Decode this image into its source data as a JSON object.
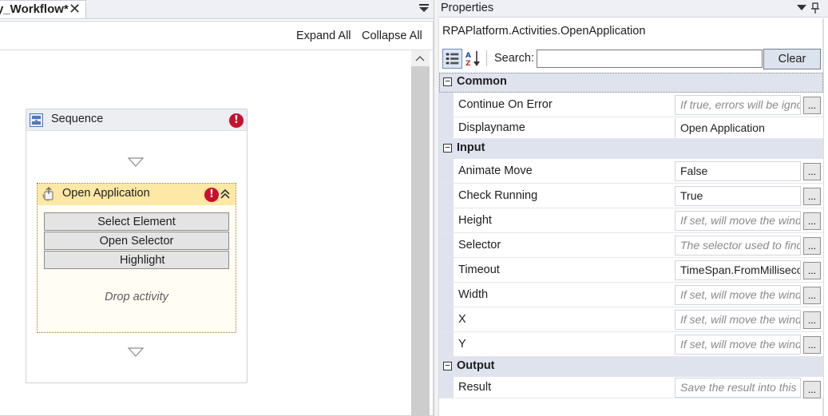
{
  "designer": {
    "tab_label": "y_Workflow*",
    "tab_close_glyph": "✕",
    "expand_all": "Expand All",
    "collapse_all": "Collapse All",
    "sequence": {
      "title": "Sequence",
      "error_glyph": "!",
      "activity": {
        "title": "Open Application",
        "error_glyph": "!",
        "buttons": {
          "select_element": "Select Element",
          "open_selector": "Open Selector",
          "highlight": "Highlight"
        },
        "drop_hint": "Drop activity"
      }
    }
  },
  "properties": {
    "panel_title": "Properties",
    "activity_type": "RPAPlatform.Activities.OpenApplication",
    "search_label": "Search:",
    "search_value": "",
    "clear_label": "Clear",
    "ellipsis_label": "...",
    "categories": [
      {
        "name": "Common",
        "toggle": "−",
        "rows": [
          {
            "name": "Continue On Error",
            "value": "If true, errors will be ignored",
            "placeholder": true
          },
          {
            "name": "Displayname",
            "value": "Open Application",
            "placeholder": false
          }
        ]
      },
      {
        "name": "Input",
        "toggle": "−",
        "rows": [
          {
            "name": "Animate Move",
            "value": "False",
            "placeholder": false
          },
          {
            "name": "Check Running",
            "value": "True",
            "placeholder": false
          },
          {
            "name": "Height",
            "value": "If set, will move the window",
            "placeholder": true
          },
          {
            "name": "Selector",
            "value": "The selector used to find",
            "placeholder": true
          },
          {
            "name": "Timeout",
            "value": "TimeSpan.FromMilliseconds",
            "placeholder": false
          },
          {
            "name": "Width",
            "value": "If set, will move the window",
            "placeholder": true
          },
          {
            "name": "X",
            "value": "If set, will move the window",
            "placeholder": true
          },
          {
            "name": "Y",
            "value": "If set, will move the window",
            "placeholder": true
          }
        ]
      },
      {
        "name": "Output",
        "toggle": "−",
        "rows": [
          {
            "name": "Result",
            "value": "Save the result into this",
            "placeholder": true
          }
        ]
      }
    ]
  },
  "colors": {
    "error_red": "#c8102e",
    "activity_header": "#fde8a6",
    "category_band": "#dfe3ee"
  },
  "icons": [
    "close-icon",
    "tab-menu-icon",
    "scroll-up-icon",
    "sequence-icon",
    "error-icon",
    "open-application-icon",
    "collapse-chevron-icon",
    "drop-arrow-icon",
    "dropdown-icon",
    "pin-icon",
    "categorized-icon",
    "alphabetical-sort-icon"
  ]
}
